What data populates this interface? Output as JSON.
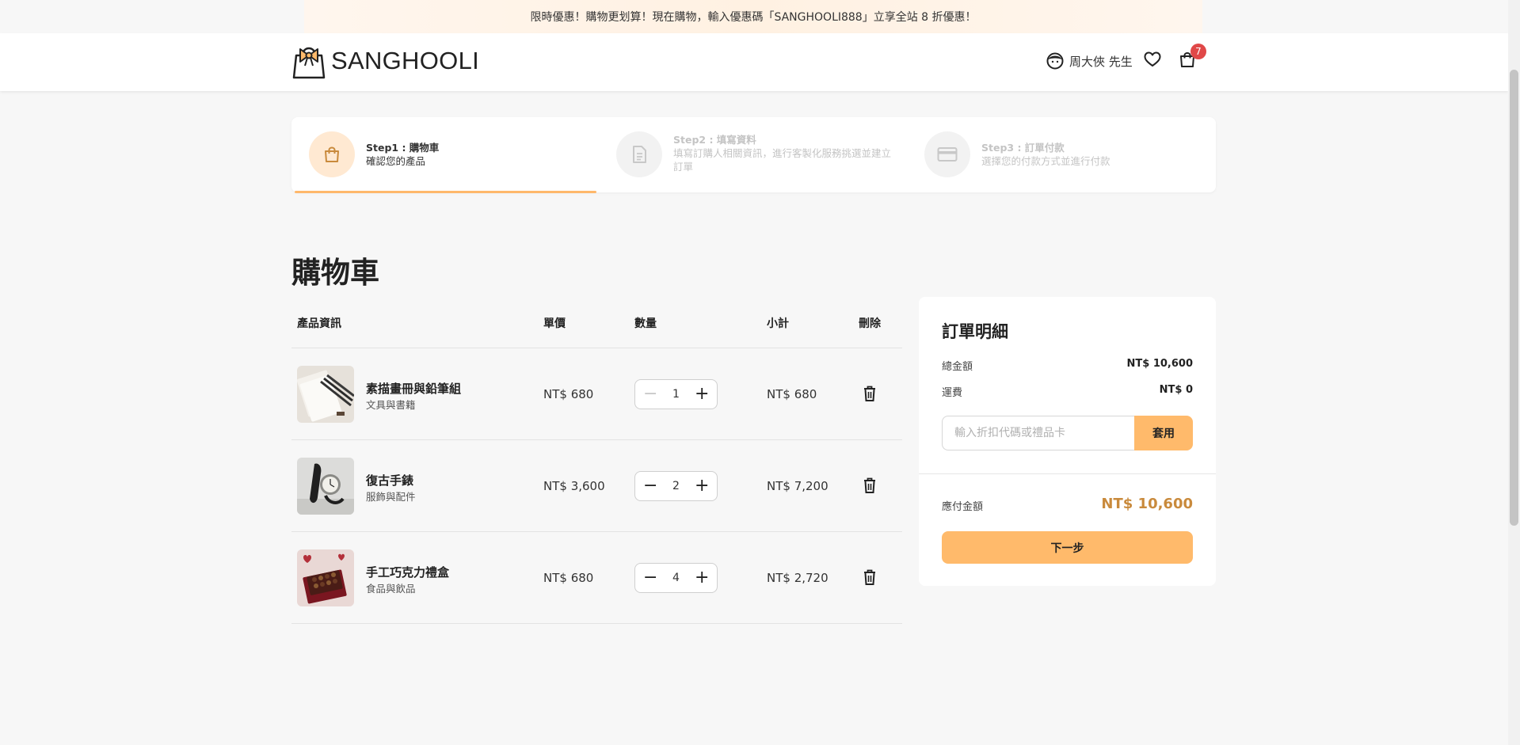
{
  "promo": {
    "text": "限時優惠！購物更划算！現在購物，輸入優惠碼「SANGHOOLI888」立享全站 8 折優惠！"
  },
  "header": {
    "logo_text": "SANGHOOLI",
    "user_name": "周大俠 先生",
    "cart_count": "7"
  },
  "steps": [
    {
      "title": "Step1 : 購物車",
      "desc": "確認您的產品",
      "state": "active"
    },
    {
      "title": "Step2 : 填寫資料",
      "desc": "填寫訂購人相關資訊，進行客製化服務挑選並建立訂單",
      "state": "inactive"
    },
    {
      "title": "Step3 : 訂單付款",
      "desc": "選擇您的付款方式並進行付款",
      "state": "inactive"
    }
  ],
  "page_title": "購物車",
  "table": {
    "headers": [
      "產品資訊",
      "單價",
      "數量",
      "小計",
      "刪除"
    ],
    "rows": [
      {
        "name": "素描畫冊與鉛筆組",
        "category": "文具與書籍",
        "price": "NT$ 680",
        "qty": "1",
        "subtotal": "NT$ 680"
      },
      {
        "name": "復古手錶",
        "category": "服飾與配件",
        "price": "NT$ 3,600",
        "qty": "2",
        "subtotal": "NT$ 7,200"
      },
      {
        "name": "手工巧克力禮盒",
        "category": "食品與飲品",
        "price": "NT$ 680",
        "qty": "4",
        "subtotal": "NT$ 2,720"
      }
    ]
  },
  "summary": {
    "title": "訂單明細",
    "total_label": "總金額",
    "total_value": "NT$ 10,600",
    "shipping_label": "運費",
    "shipping_value": "NT$ 0",
    "coupon_placeholder": "輸入折扣代碼或禮品卡",
    "coupon_button": "套用",
    "payable_label": "應付金額",
    "payable_value": "NT$ 10,600",
    "next_button": "下一步"
  },
  "colors": {
    "accent": "#ffba6b",
    "accent_text": "#c98a3c",
    "badge": "#e04848"
  }
}
